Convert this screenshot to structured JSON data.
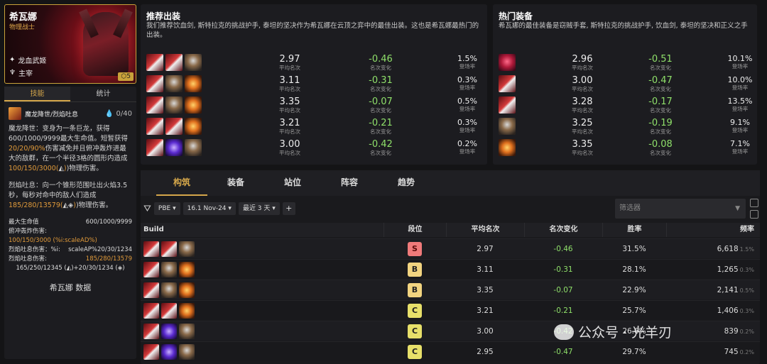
{
  "hero": {
    "name": "希瓦娜",
    "role": "物理战士",
    "trait1": "龙血武姬",
    "trait2": "主宰",
    "cost": "5"
  },
  "left_tabs": {
    "skill": "技能",
    "stats": "统计"
  },
  "skill": {
    "name": "魔龙降世/烈焰吐息",
    "mana": "0/40",
    "desc1a": "魔龙降世：变身为一条巨龙，获得600/1000/9999最大生命值。短暂获得",
    "desc1b": "20/20/90%",
    "desc1c": "伤害减免并且俯冲轰炸进最大的敌群，在一个半径3格的圆形内造成",
    "desc1d": "100/150/3000(",
    "desc1e": ")物理伤害。",
    "desc2a": "烈焰吐息：向一个锥形范围吐出火焰3.5秒，每秒对命中的敌人们造成",
    "desc2b": "185/280/13579(",
    "desc2c": ")物理伤害。",
    "stat1_label": "最大生命值",
    "stat1_value": "600/1000/9999",
    "stat2_label": "俯冲轰炸伤害:",
    "stat2_value": "100/150/3000 (%i:scaleAD%)",
    "stat3_label": "烈焰吐息伤害：%i:",
    "stat3_value": "scaleAP%20/30/1234",
    "stat4_label": "烈焰吐息伤害:",
    "stat4_value": "185/280/13579",
    "stat5_value": "165/250/12345 (",
    "stat5_tail": "+20/30/1234 (",
    "footer": "希瓦娜 数据"
  },
  "rec": {
    "title": "推荐出装",
    "sub": "我们推荐饮血剑, 斯特拉克的挑战护手, 泰坦的坚决作为希瓦娜在云顶之弈中的最佳出装。这也是希瓦娜最热门的出装。",
    "lbl_avg": "平均名次",
    "lbl_chg": "名次变化",
    "lbl_rate": "登场率",
    "rows": [
      {
        "avg": "2.97",
        "chg": "-0.46",
        "rate": "1.5%"
      },
      {
        "avg": "3.11",
        "chg": "-0.31",
        "rate": "0.3%"
      },
      {
        "avg": "3.35",
        "chg": "-0.07",
        "rate": "0.5%"
      },
      {
        "avg": "3.21",
        "chg": "-0.21",
        "rate": "0.3%"
      },
      {
        "avg": "3.00",
        "chg": "-0.42",
        "rate": "0.2%"
      }
    ]
  },
  "hot": {
    "title": "热门装备",
    "sub": "希瓦娜的最佳装备是窃贼手套, 斯特拉克的挑战护手, 饮血剑, 泰坦的坚决和正义之手",
    "rows": [
      {
        "avg": "2.96",
        "chg": "-0.51",
        "rate": "10.1%"
      },
      {
        "avg": "3.00",
        "chg": "-0.47",
        "rate": "10.0%"
      },
      {
        "avg": "3.28",
        "chg": "-0.17",
        "rate": "13.5%"
      },
      {
        "avg": "3.25",
        "chg": "-0.19",
        "rate": "9.1%"
      },
      {
        "avg": "3.35",
        "chg": "-0.08",
        "rate": "7.1%"
      }
    ]
  },
  "tabs": [
    "构筑",
    "装备",
    "站位",
    "阵容",
    "趋势"
  ],
  "filters": {
    "mode": "PBE",
    "patch": "16.1 Nov-24",
    "range": "最近 3 天",
    "search_placeholder": "筛选器"
  },
  "table": {
    "headers": [
      "Build",
      "段位",
      "平均名次",
      "名次变化",
      "胜率",
      "频率"
    ],
    "rows": [
      {
        "tier": "S",
        "avg": "2.97",
        "chg": "-0.46",
        "win": "31.5%",
        "freq": "6,618",
        "fp": "1.5%"
      },
      {
        "tier": "B",
        "avg": "3.11",
        "chg": "-0.31",
        "win": "28.1%",
        "freq": "1,265",
        "fp": "0.3%"
      },
      {
        "tier": "B",
        "avg": "3.35",
        "chg": "-0.07",
        "win": "22.9%",
        "freq": "2,141",
        "fp": "0.5%"
      },
      {
        "tier": "C",
        "avg": "3.21",
        "chg": "-0.21",
        "win": "25.7%",
        "freq": "1,406",
        "fp": "0.3%"
      },
      {
        "tier": "C",
        "avg": "3.00",
        "chg": "-0.42",
        "win": "26.6%",
        "freq": "839",
        "fp": "0.2%"
      },
      {
        "tier": "C",
        "avg": "2.95",
        "chg": "-0.47",
        "win": "29.7%",
        "freq": "745",
        "fp": "0.2%"
      }
    ]
  },
  "watermark": "公众号 · 光羊刃"
}
